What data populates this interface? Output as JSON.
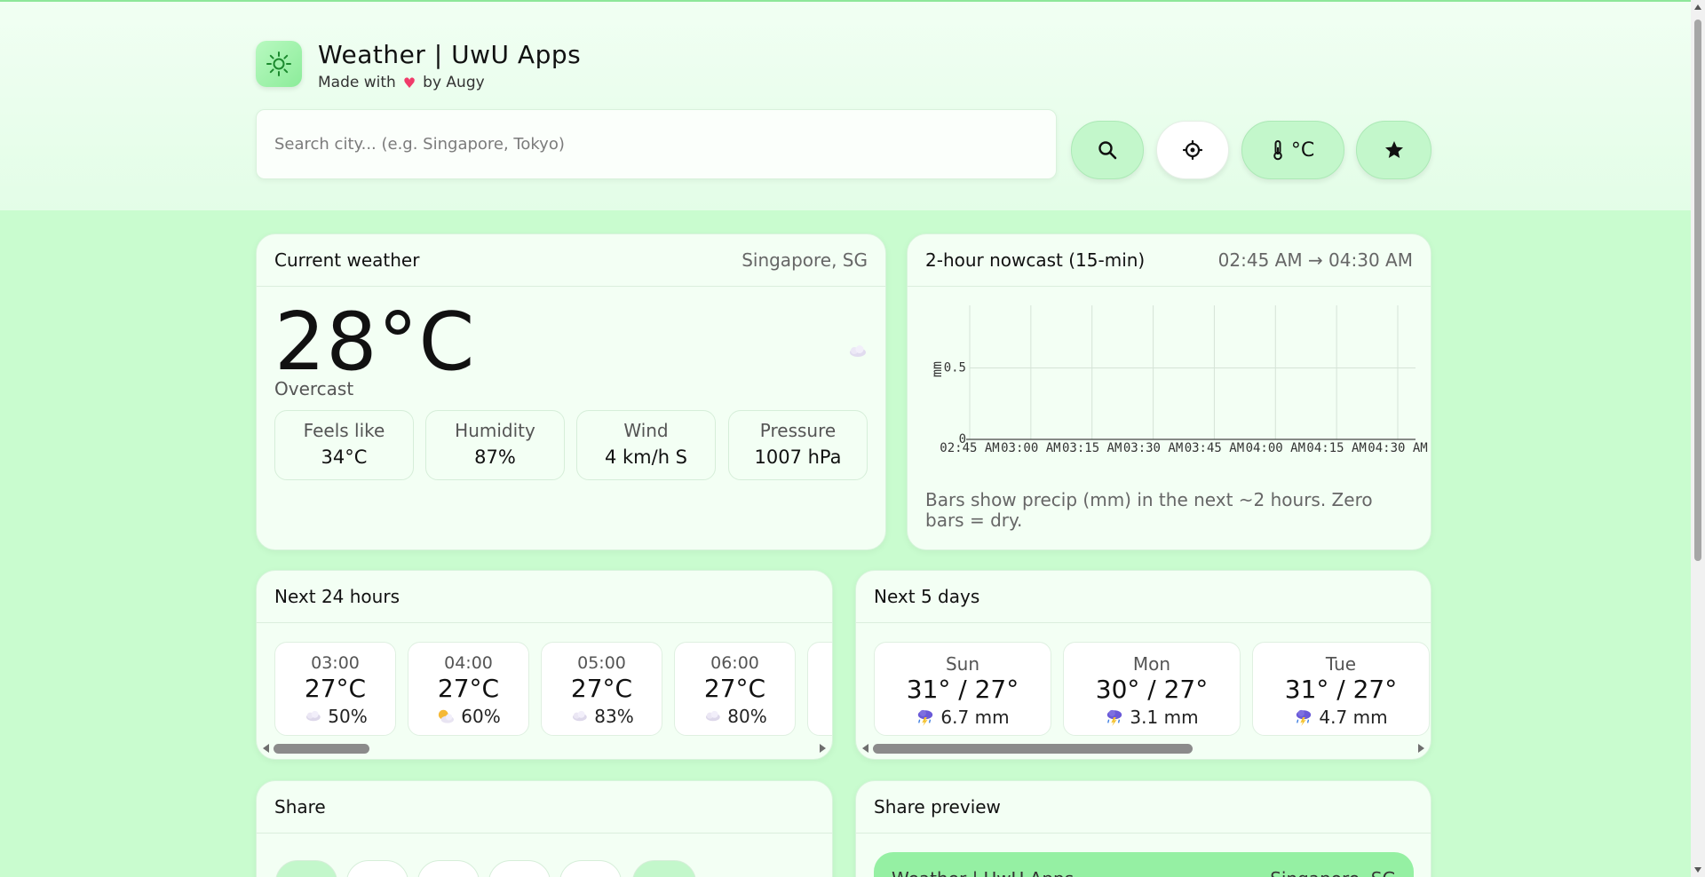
{
  "app": {
    "title": "Weather | UwU Apps",
    "subtitle_prefix": "Made with",
    "subtitle_suffix": "by Augy",
    "logo_icon": "sun-icon"
  },
  "search": {
    "placeholder": "Search city... (e.g. Singapore, Tokyo)",
    "value": ""
  },
  "toolbar": {
    "search_icon": "search-icon",
    "locate_icon": "crosshair-icon",
    "unit_label": "°C",
    "unit_icon": "thermometer-icon",
    "favorite_icon": "star-icon"
  },
  "current": {
    "title": "Current weather",
    "location": "Singapore, SG",
    "temperature": "28°C",
    "condition": "Overcast",
    "icon": "cloud-icon",
    "stats": [
      {
        "label": "Feels like",
        "value": "34°C"
      },
      {
        "label": "Humidity",
        "value": "87%"
      },
      {
        "label": "Wind",
        "value": "4 km/h S"
      },
      {
        "label": "Pressure",
        "value": "1007 hPa"
      }
    ]
  },
  "nowcast": {
    "title": "2-hour nowcast (15-min)",
    "range": "02:45 AM → 04:30 AM",
    "note": "Bars show precip (mm) in the next ~2 hours. Zero bars = dry."
  },
  "chart_data": {
    "type": "bar",
    "categories": [
      "02:45 AM",
      "03:00 AM",
      "03:15 AM",
      "03:30 AM",
      "03:45 AM",
      "04:00 AM",
      "04:15 AM",
      "04:30 AM"
    ],
    "values": [
      0,
      0,
      0,
      0,
      0,
      0,
      0,
      0
    ],
    "ylabel": "mm",
    "ylim": [
      0,
      1
    ],
    "yticks": [
      "0",
      "0.5"
    ],
    "grid": true
  },
  "hourly": {
    "title": "Next 24 hours",
    "items": [
      {
        "time": "03:00",
        "temp": "27°C",
        "pop": "50%",
        "icon": "cloud-icon"
      },
      {
        "time": "04:00",
        "temp": "27°C",
        "pop": "60%",
        "icon": "sun-cloud-icon"
      },
      {
        "time": "05:00",
        "temp": "27°C",
        "pop": "83%",
        "icon": "cloud-icon"
      },
      {
        "time": "06:00",
        "temp": "27°C",
        "pop": "80%",
        "icon": "cloud-icon"
      }
    ]
  },
  "daily": {
    "title": "Next 5 days",
    "items": [
      {
        "day": "Sun",
        "temps": "31° / 27°",
        "rain": "6.7 mm",
        "icon": "thunderstorm-icon"
      },
      {
        "day": "Mon",
        "temps": "30° / 27°",
        "rain": "3.1 mm",
        "icon": "thunderstorm-icon"
      },
      {
        "day": "Tue",
        "temps": "31° / 27°",
        "rain": "4.7 mm",
        "icon": "thunderstorm-icon"
      }
    ]
  },
  "share": {
    "title": "Share"
  },
  "share_preview": {
    "title": "Share preview",
    "app_title": "Weather | UwU Apps",
    "location": "Singapore, SG"
  },
  "colors": {
    "background": "#c9fccf",
    "card": "#f3fff4",
    "accent": "#95f0a3",
    "heart": "#f03b6a"
  }
}
